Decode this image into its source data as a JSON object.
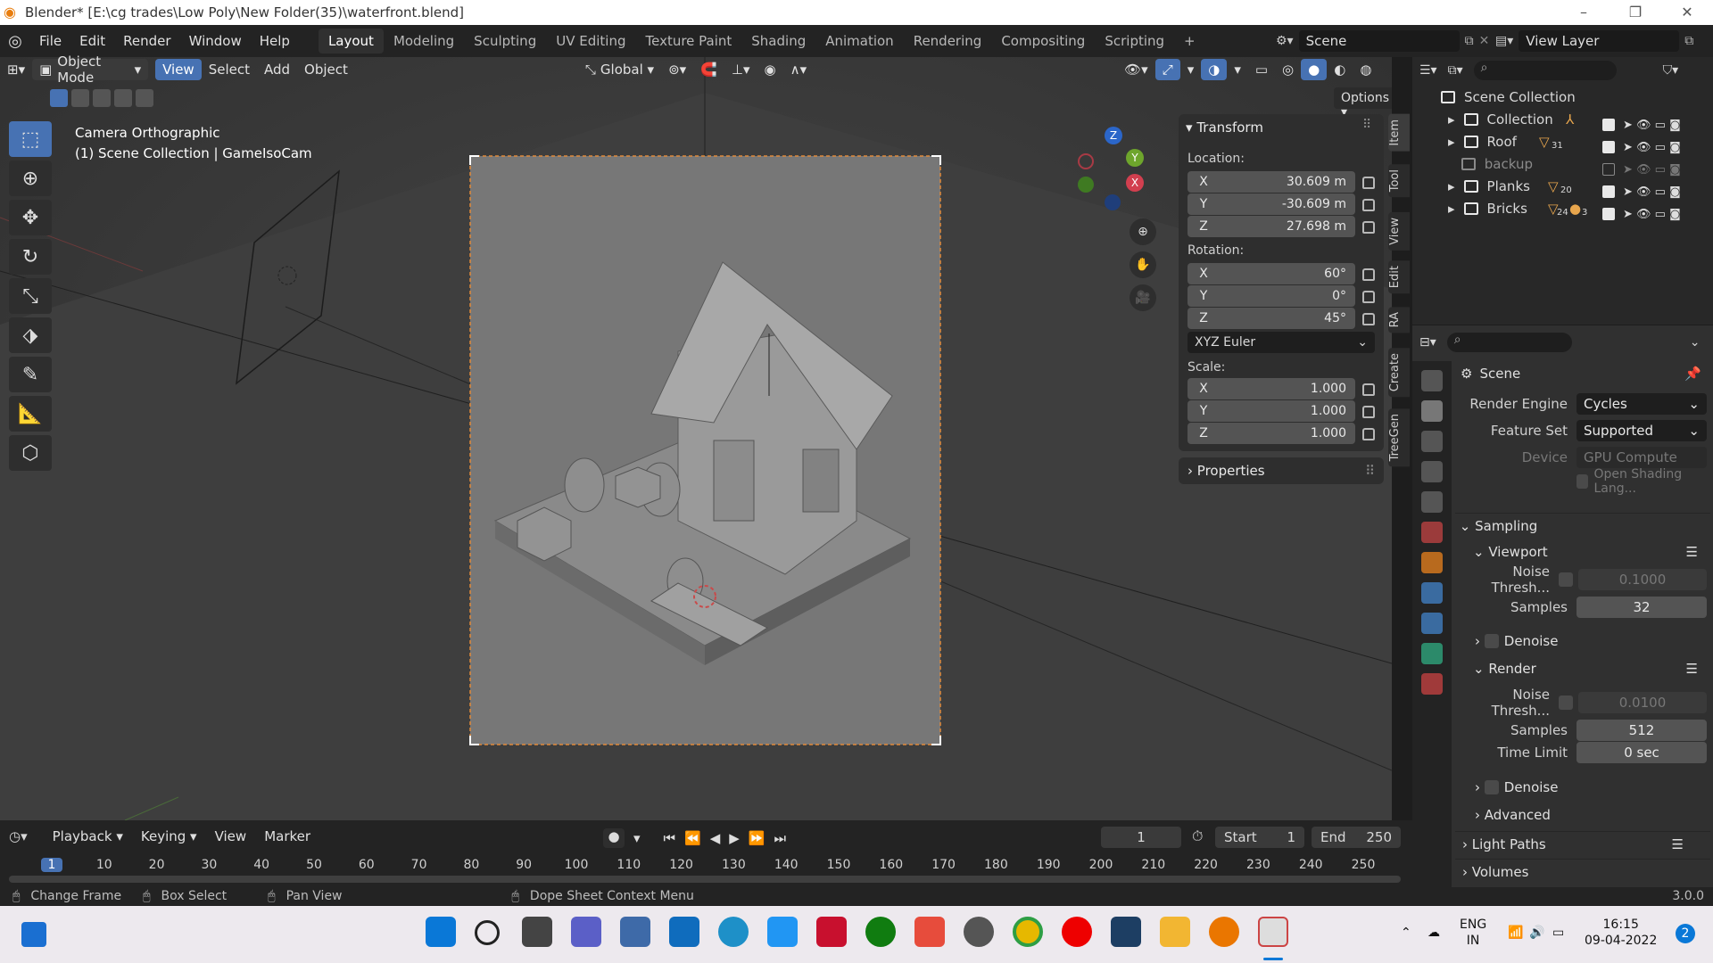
{
  "window": {
    "title": "Blender* [E:\\cg trades\\Low Poly\\New Folder(35)\\waterfront.blend]",
    "controls": [
      "–",
      "❐",
      "✕"
    ]
  },
  "menu": [
    "File",
    "Edit",
    "Render",
    "Window",
    "Help"
  ],
  "workspaces": [
    "Layout",
    "Modeling",
    "Sculpting",
    "UV Editing",
    "Texture Paint",
    "Shading",
    "Animation",
    "Rendering",
    "Compositing",
    "Scripting",
    "+"
  ],
  "scene_name": "Scene",
  "view_layer": "View Layer",
  "viewport_header": {
    "mode": "Object Mode",
    "menus": [
      "View",
      "Select",
      "Add",
      "Object"
    ],
    "transform_orientation": "Global",
    "options": "Options"
  },
  "overlay_text": {
    "camera": "Camera Orthographic",
    "collection": "(1) Scene Collection | GameIsoCam"
  },
  "gizmo_axes": {
    "x": "X",
    "y": "Y",
    "z": "Z"
  },
  "npanel": {
    "transform_title": "Transform",
    "location_label": "Location:",
    "location": [
      {
        "axis": "X",
        "value": "30.609 m"
      },
      {
        "axis": "Y",
        "value": "-30.609 m"
      },
      {
        "axis": "Z",
        "value": "27.698 m"
      }
    ],
    "rotation_label": "Rotation:",
    "rotation": [
      {
        "axis": "X",
        "value": "60°"
      },
      {
        "axis": "Y",
        "value": "0°"
      },
      {
        "axis": "Z",
        "value": "45°"
      }
    ],
    "rotation_mode": "XYZ Euler",
    "scale_label": "Scale:",
    "scale": [
      {
        "axis": "X",
        "value": "1.000"
      },
      {
        "axis": "Y",
        "value": "1.000"
      },
      {
        "axis": "Z",
        "value": "1.000"
      }
    ],
    "properties_title": "Properties",
    "side_tabs": [
      "Item",
      "Tool",
      "View",
      "Edit",
      "RA",
      "Create",
      "TreeGen"
    ]
  },
  "outliner": {
    "root": "Scene Collection",
    "items": [
      {
        "name": "Collection",
        "badge": "",
        "enabled": true
      },
      {
        "name": "Roof",
        "badge": "31",
        "enabled": true
      },
      {
        "name": "backup",
        "badge": "",
        "enabled": false
      },
      {
        "name": "Planks",
        "badge": "20",
        "enabled": true
      },
      {
        "name": "Bricks",
        "badge": "24",
        "badge2": "3",
        "enabled": true
      }
    ]
  },
  "properties": {
    "context": "Scene",
    "render_engine_label": "Render Engine",
    "render_engine": "Cycles",
    "feature_set_label": "Feature Set",
    "feature_set": "Supported",
    "device_label": "Device",
    "device": "GPU Compute",
    "osl_label": "Open Shading Lang...",
    "sampling": "Sampling",
    "viewport": "Viewport",
    "noise_thresh_label": "Noise Thresh...",
    "viewport_noise": "0.1000",
    "samples_label": "Samples",
    "viewport_samples": "32",
    "denoise": "Denoise",
    "render": "Render",
    "render_noise": "0.0100",
    "render_samples": "512",
    "time_limit_label": "Time Limit",
    "time_limit": "0 sec",
    "advanced": "Advanced",
    "light_paths": "Light Paths",
    "volumes": "Volumes"
  },
  "timeline": {
    "menus": [
      "Playback",
      "Keying",
      "View",
      "Marker"
    ],
    "current_frame": "1",
    "start_label": "Start",
    "start": "1",
    "end_label": "End",
    "end": "250",
    "ticks": [
      "1",
      "10",
      "20",
      "30",
      "40",
      "50",
      "60",
      "70",
      "80",
      "90",
      "100",
      "110",
      "120",
      "130",
      "140",
      "150",
      "160",
      "170",
      "180",
      "190",
      "200",
      "210",
      "220",
      "230",
      "240",
      "250"
    ]
  },
  "status": {
    "change_frame": "Change Frame",
    "box_select": "Box Select",
    "pan_view": "Pan View",
    "context_menu": "Dope Sheet Context Menu",
    "version": "3.0.0"
  },
  "taskbar": {
    "lang": "ENG",
    "region": "IN",
    "time": "16:15",
    "date": "09-04-2022",
    "notifications": "2"
  }
}
